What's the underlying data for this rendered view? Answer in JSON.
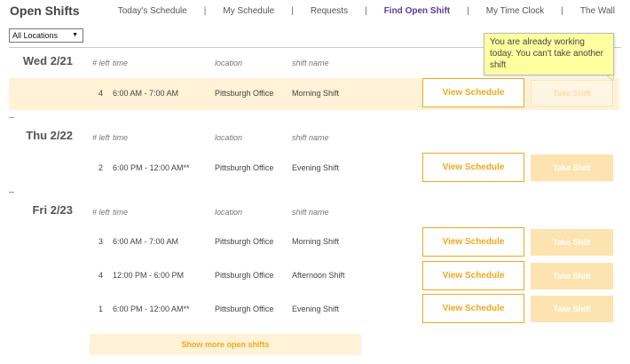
{
  "page_title": "Open Shifts",
  "nav": [
    {
      "label": "Today's Schedule",
      "active": false
    },
    {
      "label": "My Schedule",
      "active": false
    },
    {
      "label": "Requests",
      "active": false
    },
    {
      "label": "Find Open Shift",
      "active": true
    },
    {
      "label": "My Time Clock",
      "active": false
    },
    {
      "label": "The Wall",
      "active": false
    }
  ],
  "nav_separator": "|",
  "location_filter": {
    "value": "All Locations",
    "caret": "▼"
  },
  "tooltip": {
    "text": "You are already working today. You can't take another shift"
  },
  "headers": {
    "num_left": "# left",
    "time": "time",
    "location": "location",
    "shift_name": "shift name"
  },
  "days": [
    {
      "date": "Wed 2/21",
      "shifts": [
        {
          "left": "4",
          "time": "6:00 AM - 7:00 AM",
          "location": "Pittsburgh Office",
          "name": "Morning Shift",
          "view_label": "View Schedule",
          "take_label": "Take Shift",
          "take_disabled": true
        }
      ]
    },
    {
      "date": "Thu 2/22",
      "shifts": [
        {
          "left": "2",
          "time": "6:00 PM - 12:00 AM**",
          "location": "Pittsburgh Office",
          "name": "Evening Shift",
          "view_label": "View Schedule",
          "take_label": "Take Shift",
          "take_disabled": false
        }
      ]
    },
    {
      "date": "Fri 2/23",
      "shifts": [
        {
          "left": "3",
          "time": "6:00 AM - 7:00 AM",
          "location": "Pittsburgh Office",
          "name": "Morning Shift",
          "view_label": "View Schedule",
          "take_label": "Take Shift",
          "take_disabled": false
        },
        {
          "left": "4",
          "time": "12:00 PM - 6:00 PM",
          "location": "Pittsburgh Office",
          "name": "Afternoon Shift",
          "view_label": "View Schedule",
          "take_label": "Take Shift",
          "take_disabled": false
        },
        {
          "left": "1",
          "time": "6:00 PM - 12:00 AM**",
          "location": "Pittsburgh Office",
          "name": "Evening Shift",
          "view_label": "View Schedule",
          "take_label": "Take Shift",
          "take_disabled": false
        }
      ]
    }
  ],
  "show_more_label": "Show more open shifts",
  "colors": {
    "accent": "#f0a821",
    "nav_active": "#5b3e8c",
    "highlight_row": "#fff2d6",
    "take_button": "#fde3b0",
    "tooltip_bg": "#ffffa0"
  }
}
